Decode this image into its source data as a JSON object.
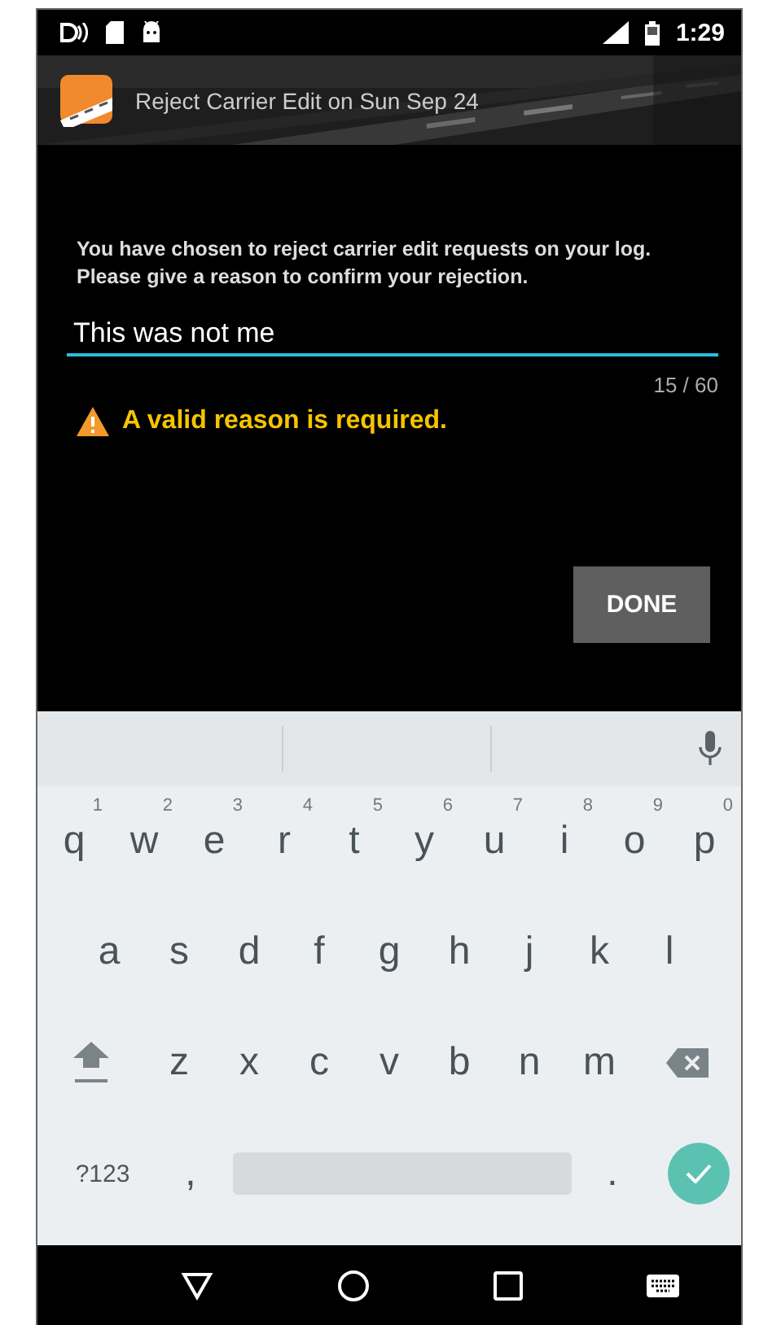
{
  "status_bar": {
    "time": "1:29"
  },
  "app_bar": {
    "title": "Reject Carrier Edit on Sun Sep 24"
  },
  "message": "You have chosen to reject carrier edit requests on your log. Please give a reason to confirm your rejection.",
  "reason_field": {
    "value": "This was not me"
  },
  "counter": "15 / 60",
  "error": "A valid reason is required.",
  "done_button": "DONE",
  "keyboard": {
    "rows": [
      [
        {
          "label": "q",
          "hint": "1"
        },
        {
          "label": "w",
          "hint": "2"
        },
        {
          "label": "e",
          "hint": "3"
        },
        {
          "label": "r",
          "hint": "4"
        },
        {
          "label": "t",
          "hint": "5"
        },
        {
          "label": "y",
          "hint": "6"
        },
        {
          "label": "u",
          "hint": "7"
        },
        {
          "label": "i",
          "hint": "8"
        },
        {
          "label": "o",
          "hint": "9"
        },
        {
          "label": "p",
          "hint": "0"
        }
      ],
      [
        {
          "label": "a"
        },
        {
          "label": "s"
        },
        {
          "label": "d"
        },
        {
          "label": "f"
        },
        {
          "label": "g"
        },
        {
          "label": "h"
        },
        {
          "label": "j"
        },
        {
          "label": "k"
        },
        {
          "label": "l"
        }
      ],
      [
        {
          "label": "z"
        },
        {
          "label": "x"
        },
        {
          "label": "c"
        },
        {
          "label": "v"
        },
        {
          "label": "b"
        },
        {
          "label": "n"
        },
        {
          "label": "m"
        }
      ]
    ],
    "symbols_key": "?123",
    "comma_key": ",",
    "period_key": "."
  }
}
